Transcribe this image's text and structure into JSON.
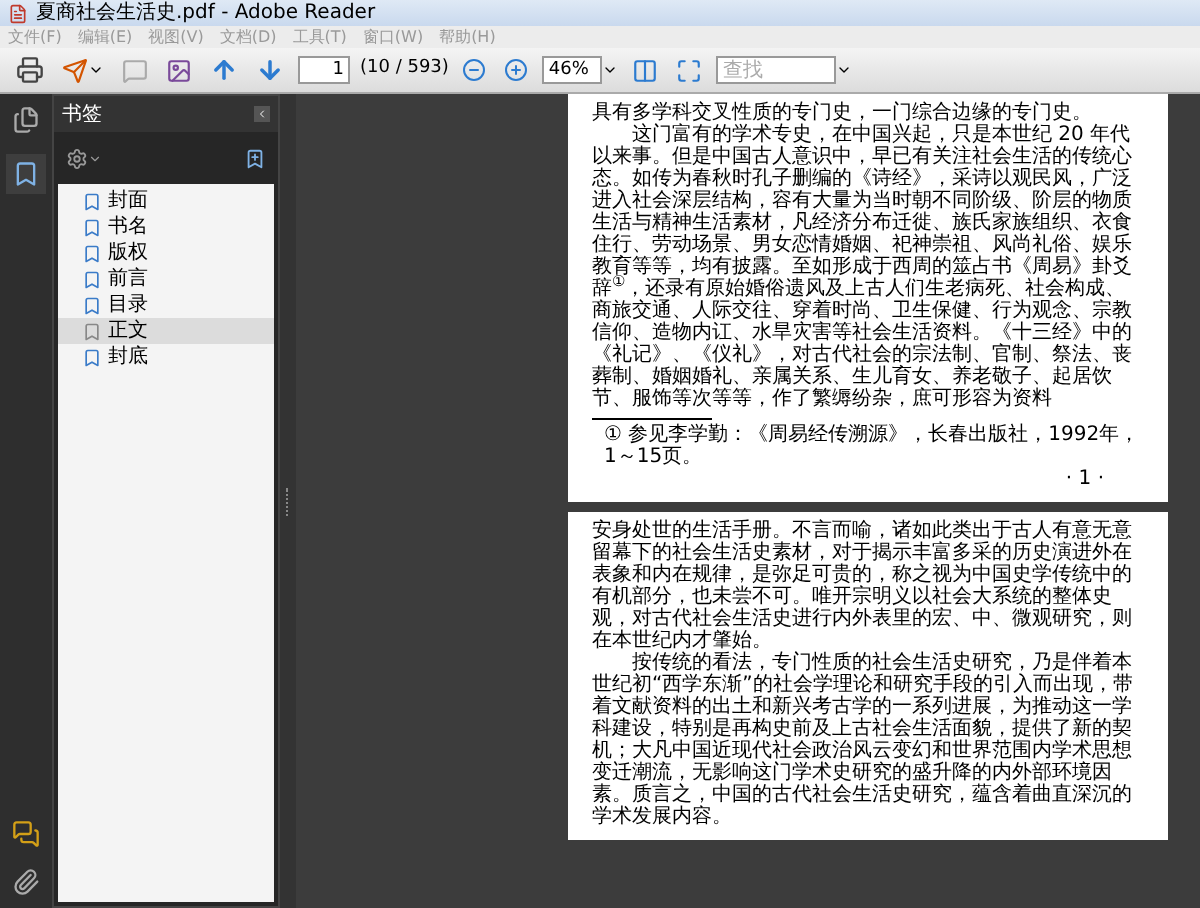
{
  "window": {
    "title": "夏商社会生活史.pdf - Adobe Reader"
  },
  "menu": [
    "文件(F)",
    "编辑(E)",
    "视图(V)",
    "文档(D)",
    "工具(T)",
    "窗口(W)",
    "帮助(H)"
  ],
  "toolbar": {
    "page": "1",
    "page_count": "(10 / 593)",
    "zoom": "46%",
    "search_placeholder": "查找"
  },
  "bookmarks": {
    "title": "书签",
    "items": [
      {
        "label": "封面",
        "selected": false
      },
      {
        "label": "书名",
        "selected": false
      },
      {
        "label": "版权",
        "selected": false
      },
      {
        "label": "前言",
        "selected": false
      },
      {
        "label": "目录",
        "selected": false
      },
      {
        "label": "正文",
        "selected": true
      },
      {
        "label": "封底",
        "selected": false
      }
    ]
  },
  "pages": [
    {
      "paragraphs": [
        {
          "text": "具有多学科交叉性质的专门史，一门综合边缘的专门史。",
          "indented": false
        },
        {
          "text": "这门富有的学术专史，在中国兴起，只是本世纪 20 年代以来事。但是中国古人意识中，早已有关注社会生活的传统心态。如传为春秋时孔子删编的《诗经》，采诗以观民风，广泛进入社会深层结构，容有大量为当时朝不同阶级、阶层的物质生活与精神生活素材，凡经济分布迁徙、族氏家族组织、衣食住行、劳动场景、男女恋情婚姻、祀神崇祖、风尚礼俗、娱乐教育等等，均有披露。至如形成于西周的筮占书《周易》卦爻辞$^{①}$，还录有原始婚俗遗风及上古人们生老病死、社会构成、商旅交通、人际交往、穿着时尚、卫生保健、行为观念、宗教信仰、造物内讧、水旱灾害等社会生活资料。《十三经》中的《礼记》、《仪礼》，对古代社会的宗法制、官制、祭法、丧葬制、婚姻婚礼、亲属关系、生儿育女、养老敬子、起居饮节、服饰等次等等，作了繁缛纷杂，庶可形容为资料",
          "indented": true
        }
      ],
      "footnote": "① 参见李学勤：《周易经传溯源》，长春出版社，1992年，1～15页。",
      "page_number": "· 1 ·"
    },
    {
      "paragraphs": [
        {
          "text": "安身处世的生活手册。不言而喻，诸如此类出于古人有意无意留幕下的社会生活史素材，对于揭示丰富多采的历史演进外在表象和内在规律，是弥足可贵的，称之视为中国史学传统中的有机部分，也未尝不可。唯开宗明义以社会大系统的整体史观，对古代社会生活史进行内外表里的宏、中、微观研究，则在本世纪内才肇始。",
          "indented": false
        },
        {
          "text": "按传统的看法，专门性质的社会生活史研究，乃是伴着本世纪初“西学东渐”的社会学理论和研究手段的引入而出现，带着文献资料的出土和新兴考古学的一系列进展，为推动这一学科建设，特别是再构史前及上古社会生活面貌，提供了新的契机；大凡中国近现代社会政治风云变幻和世界范围内学术思想变迁潮流，无影响这门学术史研究的盛升降的内外部环境因素。质言之，中国的古代社会生活史研究，蕴含着曲直深沉的学术发展内容。",
          "indented": true
        }
      ]
    }
  ]
}
